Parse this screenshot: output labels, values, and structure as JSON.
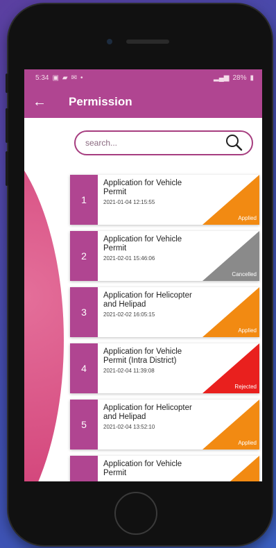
{
  "status_bar": {
    "time": "5:34",
    "icons_left": [
      "image-icon",
      "message-icon",
      "mail-icon",
      "dot-icon"
    ],
    "signal": "···",
    "battery": "28%"
  },
  "app_bar": {
    "title": "Permission"
  },
  "search": {
    "placeholder": "search..."
  },
  "colors": {
    "brand": "#b04591",
    "applied": "#f28a12",
    "cancelled": "#8a8a8a",
    "rejected": "#e9201e"
  },
  "applications": [
    {
      "number": "1",
      "title": "Application for Vehicle Permit",
      "date": "2021-01-04 12:15:55",
      "status": "Applied",
      "status_color": "#f28a12"
    },
    {
      "number": "2",
      "title": "Application for Vehicle Permit",
      "date": "2021-02-01 15:46:06",
      "status": "Cancelled",
      "status_color": "#8a8a8a"
    },
    {
      "number": "3",
      "title": "Application for Helicopter and Helipad",
      "date": "2021-02-02 16:05:15",
      "status": "Applied",
      "status_color": "#f28a12"
    },
    {
      "number": "4",
      "title": "Application for Vehicle Permit (Intra District)",
      "date": "2021-02-04 11:39:08",
      "status": "Rejected",
      "status_color": "#e9201e"
    },
    {
      "number": "5",
      "title": "Application for Helicopter and Helipad",
      "date": "2021-02-04 13:52:10",
      "status": "Applied",
      "status_color": "#f28a12"
    },
    {
      "number": "",
      "title": "Application for Vehicle Permit",
      "date": "",
      "status": "",
      "status_color": "#f28a12"
    }
  ]
}
